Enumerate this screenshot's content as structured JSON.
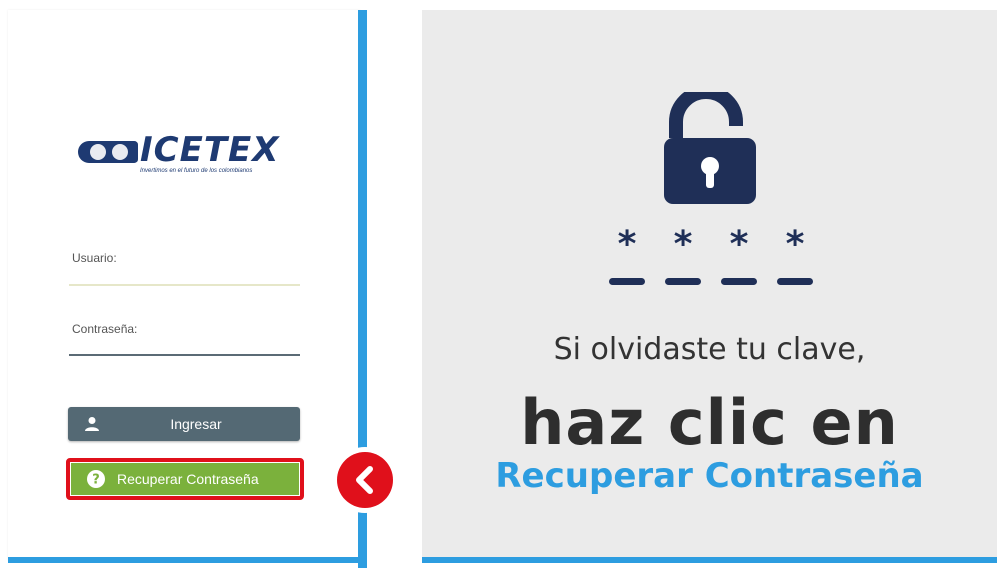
{
  "login": {
    "logo": {
      "name": "ICETEX",
      "tagline": "Invertimos en el futuro de los colombianos"
    },
    "usuario_label": "Usuario:",
    "password_label": "Contraseña:",
    "login_button": "Ingresar",
    "recover_button": "Recuperar Contraseña"
  },
  "icons": {
    "user": "user-icon",
    "help": "help-circle-icon",
    "back": "chevron-left-icon",
    "lock": "unlocked-padlock-icon"
  },
  "info": {
    "masked_password": [
      "*",
      "*",
      "*",
      "*"
    ],
    "line1": "Si olvidaste tu clave,",
    "line2": "haz clic en",
    "line3": "Recuperar Contraseña"
  },
  "colors": {
    "accent_blue": "#2d9de0",
    "navy": "#1f2f57",
    "highlight_red": "#e0101b",
    "recover_green": "#7bb13c",
    "login_gray": "#546974"
  }
}
